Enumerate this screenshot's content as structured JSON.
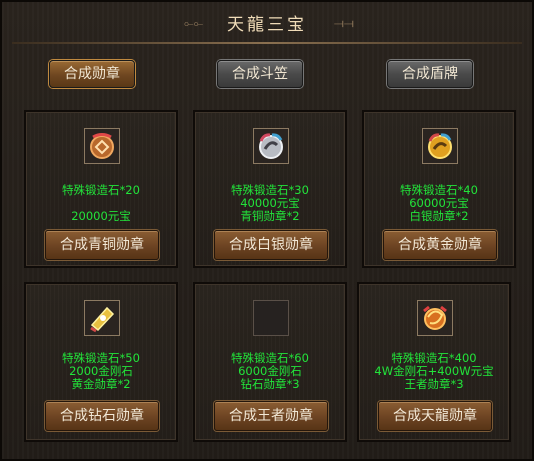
{
  "title": "天龍三宝",
  "tabs": [
    {
      "label": "合成勋章",
      "active": true
    },
    {
      "label": "合成斗笠",
      "active": false
    },
    {
      "label": "合成盾牌",
      "active": false
    }
  ],
  "cards": [
    {
      "icon": "bronze-medal-icon",
      "req": [
        "特殊锻造石*20",
        "20000元宝"
      ],
      "button": "合成青铜勋章"
    },
    {
      "icon": "silver-medal-icon",
      "req": [
        "特殊锻造石*30",
        "40000元宝",
        "青铜勋章*2"
      ],
      "button": "合成白银勋章"
    },
    {
      "icon": "gold-medal-icon",
      "req": [
        "特殊锻造石*40",
        "60000元宝",
        "白银勋章*2"
      ],
      "button": "合成黄金勋章"
    },
    {
      "icon": "diamond-medal-icon",
      "req": [
        "特殊锻造石*50",
        "2000金刚石",
        "黄金勋章*2"
      ],
      "button": "合成钻石勋章"
    },
    {
      "icon": "empty-slot-icon",
      "req": [
        "特殊锻造石*60",
        "6000金刚石",
        "钻石勋章*3"
      ],
      "button": "合成王者勋章"
    },
    {
      "icon": "dragon-medal-icon",
      "req": [
        "特殊锻造石*400",
        "4W金刚石+400W元宝",
        "王者勋章*3"
      ],
      "button": "合成天龍勋章"
    }
  ],
  "colors": {
    "requirement_text": "#22e43a",
    "title_text": "#f0dcb8"
  }
}
